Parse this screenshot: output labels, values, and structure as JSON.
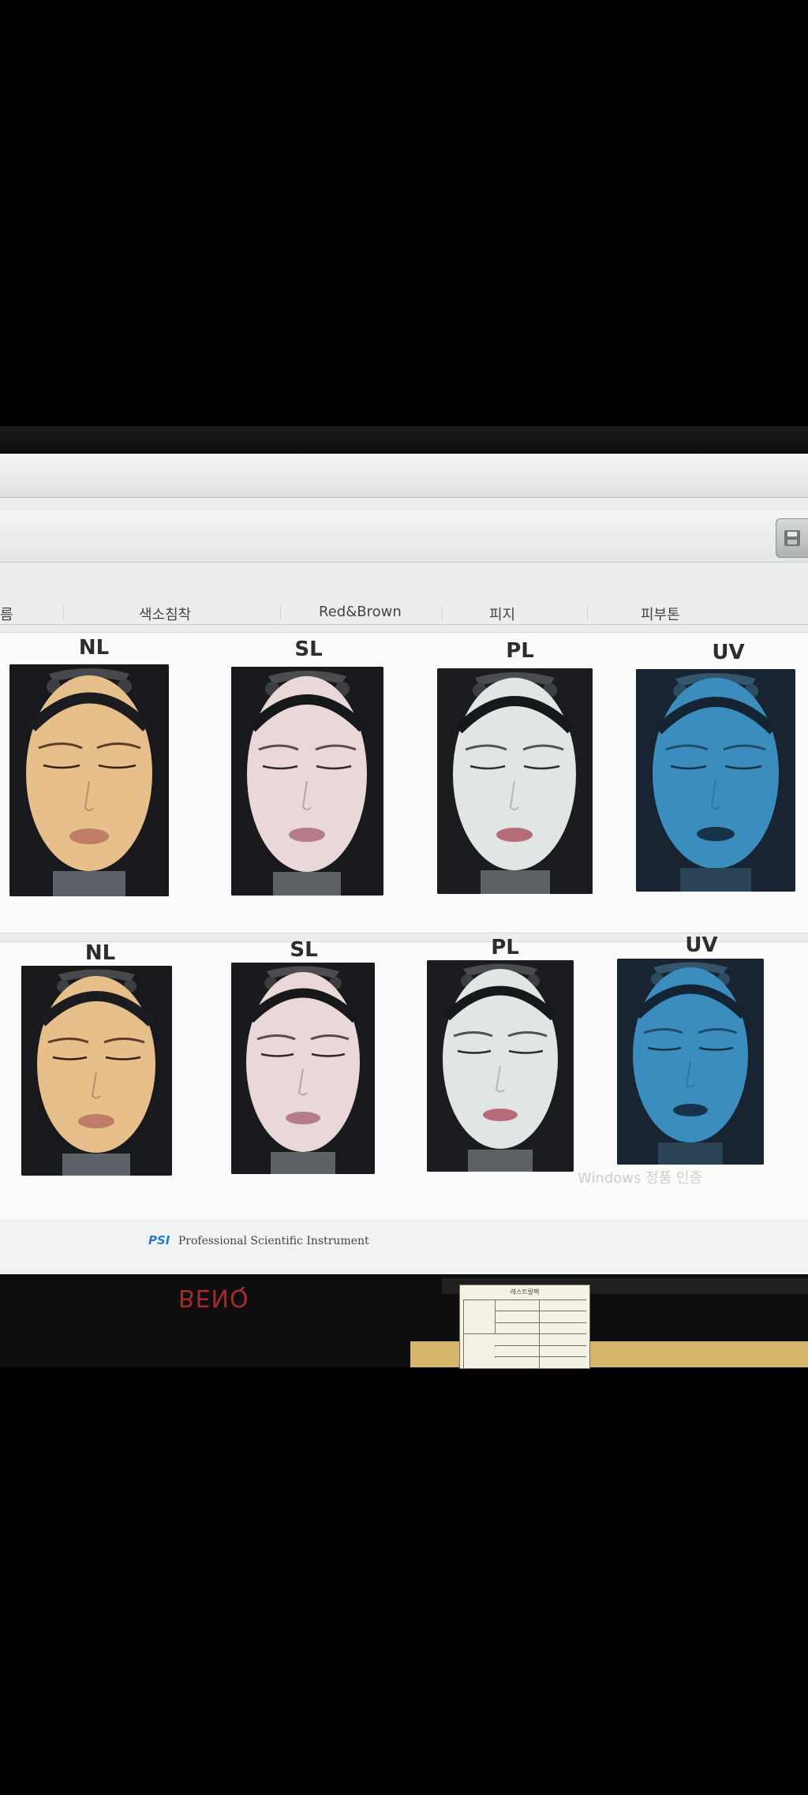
{
  "tabs": [
    "름",
    "색소침착",
    "Red&Brown",
    "피지",
    "피부톤"
  ],
  "panels": [
    {
      "labels": [
        "NL",
        "SL",
        "PL",
        "UV"
      ]
    },
    {
      "labels": [
        "NL",
        "SL",
        "PL",
        "UV"
      ]
    }
  ],
  "footer": {
    "brand_mark": "PSI",
    "brand_text": "Professional Scientific Instrument"
  },
  "watermark": "Windows 정품 인증",
  "bezel_brand": "BENQ",
  "note": {
    "title": "레스트랄팩"
  },
  "colors": {
    "nl_skin": "#e6bf8b",
    "sl_skin": "#ead8d8",
    "pl_skin": "#dfe6e4",
    "uv_skin": "#3b8dbd"
  }
}
